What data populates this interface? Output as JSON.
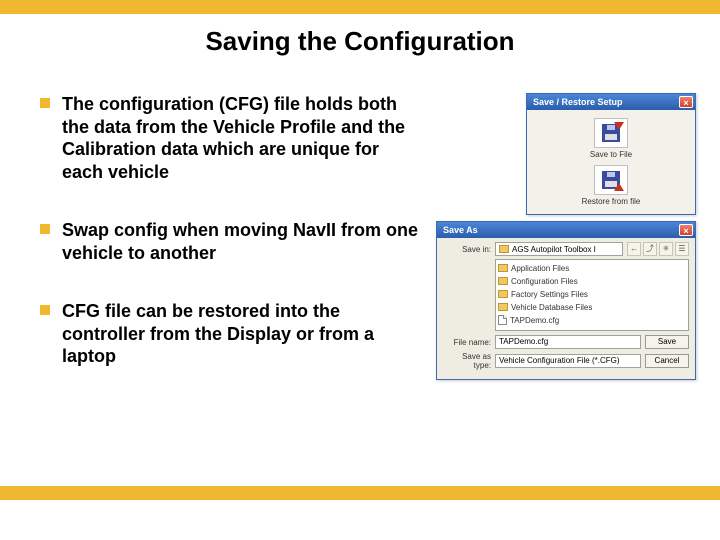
{
  "title": "Saving the Configuration",
  "bullets": [
    "The configuration (CFG) file holds both the data from the Vehicle Profile and the Calibration data which are unique for each vehicle",
    "Swap config when moving NavII from one vehicle to another",
    "CFG file can be restored into the controller from the Display or from a laptop"
  ],
  "dialog1": {
    "title": "Save / Restore Setup",
    "save_caption": "Save to File",
    "restore_caption": "Restore from file"
  },
  "dialog2": {
    "title": "Save As",
    "savein_label": "Save in:",
    "savein_value": "AGS Autopilot Toolbox I",
    "toolbar_back": "←",
    "files": [
      {
        "type": "folder",
        "name": "Application Files"
      },
      {
        "type": "folder",
        "name": "Configuration Files"
      },
      {
        "type": "folder",
        "name": "Factory Settings Files"
      },
      {
        "type": "folder",
        "name": "Vehicle Database Files"
      },
      {
        "type": "file",
        "name": "TAPDemo.cfg"
      }
    ],
    "filename_label": "File name:",
    "filename_value": "TAPDemo.cfg",
    "savetype_label": "Save as type:",
    "savetype_value": "Vehicle Configuration File (*.CFG)",
    "save_btn": "Save",
    "cancel_btn": "Cancel"
  }
}
